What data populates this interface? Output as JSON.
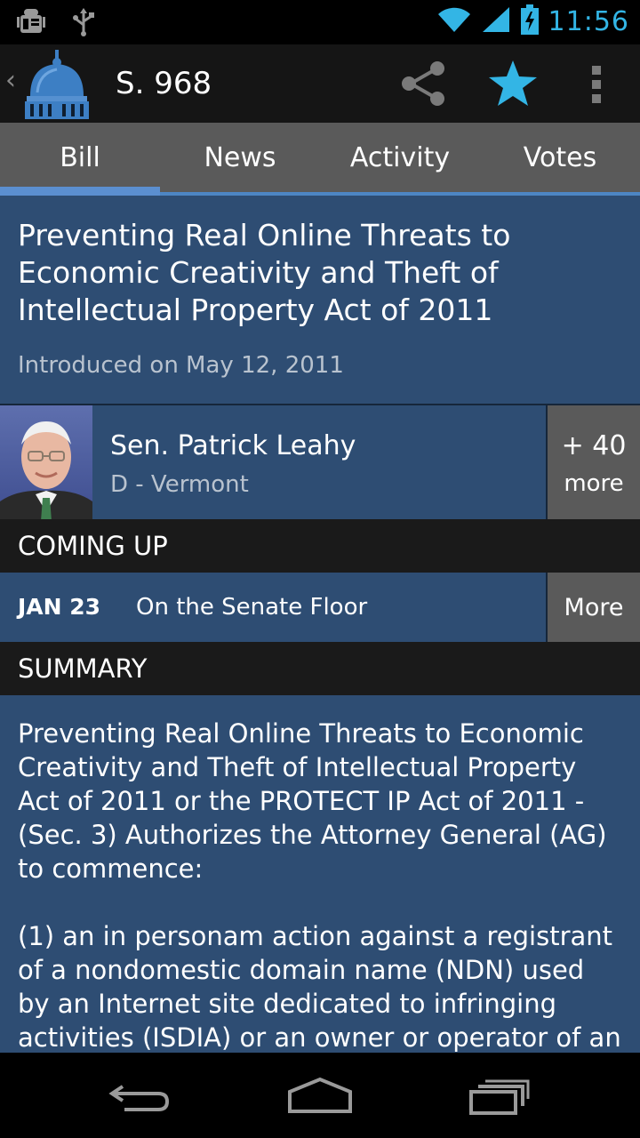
{
  "status_bar": {
    "time": "11:56",
    "icons": [
      "android-debug-icon",
      "usb-icon",
      "wifi-icon",
      "signal-icon",
      "battery-charging-icon"
    ]
  },
  "action_bar": {
    "title": "S. 968",
    "icons": [
      "up-caret-icon",
      "capitol-logo",
      "share-icon",
      "star-icon",
      "overflow-menu-icon"
    ],
    "accent": "#33b5e5"
  },
  "tabs": [
    {
      "label": "Bill",
      "active": true
    },
    {
      "label": "News",
      "active": false
    },
    {
      "label": "Activity",
      "active": false
    },
    {
      "label": "Votes",
      "active": false
    }
  ],
  "bill": {
    "title": "Preventing Real Online Threats to Economic Creativity and Theft of Intellectual Property Act of 2011",
    "introduced": "Introduced on May 12, 2011"
  },
  "sponsor": {
    "name": "Sen. Patrick Leahy",
    "party_state": "D - Vermont",
    "more_count": "+ 40",
    "more_label": "more"
  },
  "coming_up": {
    "header": "COMING UP",
    "date": "JAN 23",
    "description": "On the Senate Floor",
    "more_label": "More"
  },
  "summary": {
    "header": "SUMMARY",
    "paragraph_1": "Preventing Real Online Threats to Economic Creativity and Theft of Intellectual Property Act of 2011 or the PROTECT IP Act of 2011 - (Sec. 3) Authorizes the Attorney General (AG) to commence:",
    "paragraph_2": "(1) an in personam action against a registrant of a nondomestic domain name (NDN) used by an Internet site dedicated to infringing activities (ISDIA) or an owner or operator of an"
  },
  "nav_bar": {
    "icons": [
      "back-icon",
      "home-icon",
      "recent-apps-icon"
    ]
  },
  "colors": {
    "content_blue": "#2e4d73",
    "tab_gray": "#5a5a5a",
    "tab_indicator": "#5b8fd0",
    "section_header": "#1a1a1a"
  }
}
